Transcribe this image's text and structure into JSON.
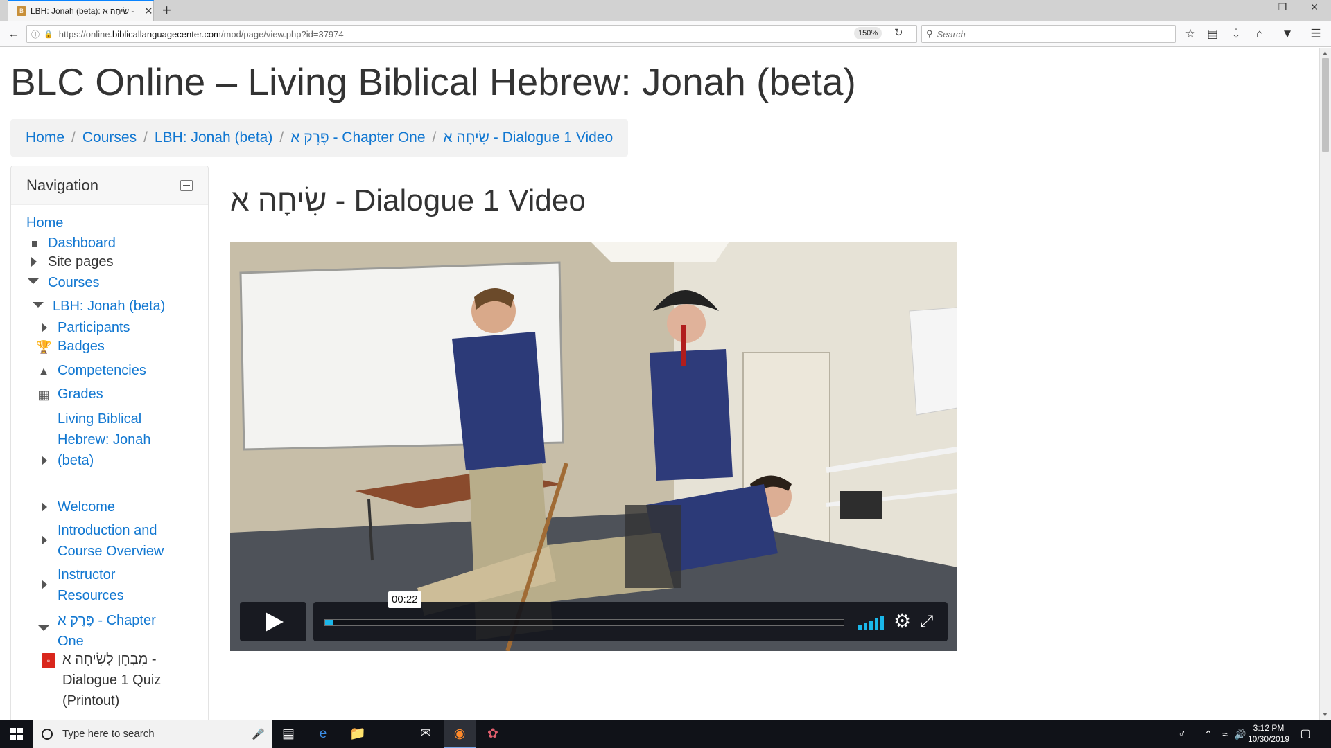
{
  "browser": {
    "tab_title": "LBH: Jonah (beta): שִׂיחָה א -",
    "tab_close": "✕",
    "new_tab": "+",
    "window_controls": {
      "minimize": "—",
      "maximize": "❐",
      "close": "✕"
    },
    "url_prefix": "https://online.",
    "url_domain": "biblicallanguagecenter.com",
    "url_path": "/mod/page/view.php?id=37974",
    "zoom": "150%",
    "search_placeholder": "Search"
  },
  "site": {
    "title": "BLC Online – Living Biblical Hebrew: Jonah (beta)"
  },
  "breadcrumb": [
    "Home",
    "Courses",
    "LBH: Jonah (beta)",
    "פֶּרֶק א - Chapter One",
    "שִׂיחָה א - Dialogue 1 Video"
  ],
  "navigation": {
    "title": "Navigation",
    "items": [
      {
        "label": "Home",
        "icon": "none",
        "link": true
      },
      {
        "label": "Dashboard",
        "icon": "bullet-icon",
        "link": true
      },
      {
        "label": "Site pages",
        "icon": "expand-icon",
        "link": false
      },
      {
        "label": "Courses",
        "icon": "collapse-icon",
        "link": true
      },
      {
        "label": "LBH: Jonah (beta)",
        "icon": "collapse-icon",
        "link": true
      },
      {
        "label": "Participants",
        "icon": "expand-icon",
        "link": true
      },
      {
        "label": "Badges",
        "icon": "trophy-icon",
        "link": true
      },
      {
        "label": "Competencies",
        "icon": "competency-icon",
        "link": true
      },
      {
        "label": "Grades",
        "icon": "grades-icon",
        "link": true
      },
      {
        "label_lines": [
          "Living Biblical",
          "Hebrew: Jonah",
          "(beta)"
        ],
        "icon": "expand-icon",
        "link": true
      },
      {
        "label": "Welcome",
        "icon": "expand-icon",
        "link": true
      },
      {
        "label_lines": [
          "Introduction and",
          "Course Overview"
        ],
        "icon": "expand-icon",
        "link": true
      },
      {
        "label_lines": [
          "Instructor",
          "Resources"
        ],
        "icon": "expand-icon",
        "link": true
      },
      {
        "label_lines": [
          "פֶּרֶק א - Chapter",
          "One"
        ],
        "icon": "collapse-icon",
        "link": true
      },
      {
        "label_lines": [
          "מִבְחָן לְשִׂיחָה א -",
          "Dialogue 1 Quiz",
          "(Printout)"
        ],
        "icon": "pdf-icon",
        "link": false
      }
    ]
  },
  "main": {
    "page_title": "שִׂיחָה א - Dialogue 1 Video",
    "video": {
      "time_display": "00:22",
      "progress_fraction": 0.016,
      "volume_fraction": 1.0
    }
  },
  "taskbar": {
    "search_placeholder": "Type here to search",
    "time": "3:12 PM",
    "date": "10/30/2019"
  },
  "colors": {
    "link": "#1177d1",
    "vimeo_accent": "#1ab7ea",
    "taskbar": "#101218"
  }
}
